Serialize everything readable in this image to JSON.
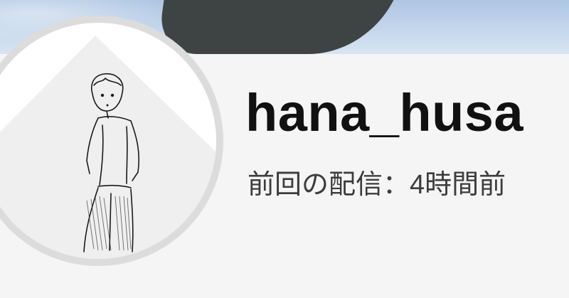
{
  "profile": {
    "username": "hana_husa",
    "last_stream": "前回の配信：4時間前"
  },
  "icons": {
    "avatar": "line-drawing-person-icon"
  },
  "colors": {
    "background": "#f5f5f5",
    "username_text": "#111111",
    "subtitle_text": "#3c3c3c",
    "avatar_ring": "#dcdcdc"
  }
}
